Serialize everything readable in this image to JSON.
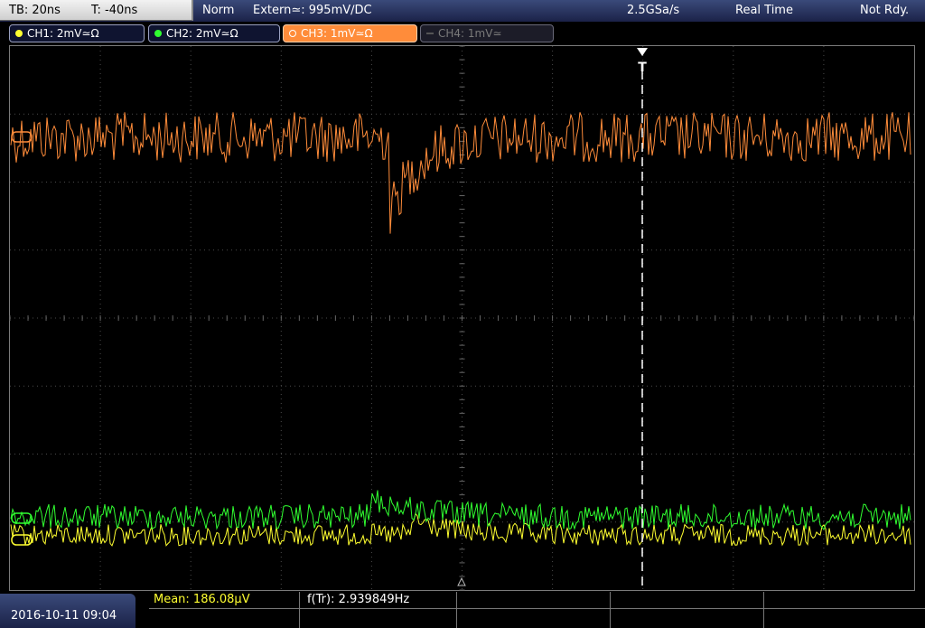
{
  "top_bar": {
    "timebase": "TB: 20ns",
    "trigger_offset": "T: -40ns",
    "trigger_mode": "Norm",
    "trigger_source": "Extern≃: 995mV∕DC",
    "sample_rate": "2.5GSa/s",
    "acq_mode": "Real Time",
    "status": "Not Rdy."
  },
  "channels": [
    {
      "label": "CH1: 2mV≃Ω",
      "color": "#ffff30",
      "active": true
    },
    {
      "label": "CH2: 2mV≃Ω",
      "color": "#30ff30",
      "active": true
    },
    {
      "label": "CH3: 1mV≃Ω",
      "color": "#ff8c3a",
      "active": true,
      "selected": true
    },
    {
      "label": "CH4: 1mV≃",
      "color": "#777777",
      "active": false
    }
  ],
  "trigger_marker": "T",
  "bottom_bar": {
    "datetime": "2016-10-11 09:04",
    "meas1": "Mean: 186.08µV",
    "meas2": "f(Tr): 2.939849Hz"
  },
  "colors": {
    "ch1": "#ffff30",
    "ch2": "#30ff30",
    "ch3": "#ff8c3a",
    "grid": "#4a4a4a",
    "meas_label": "#ffff30"
  }
}
